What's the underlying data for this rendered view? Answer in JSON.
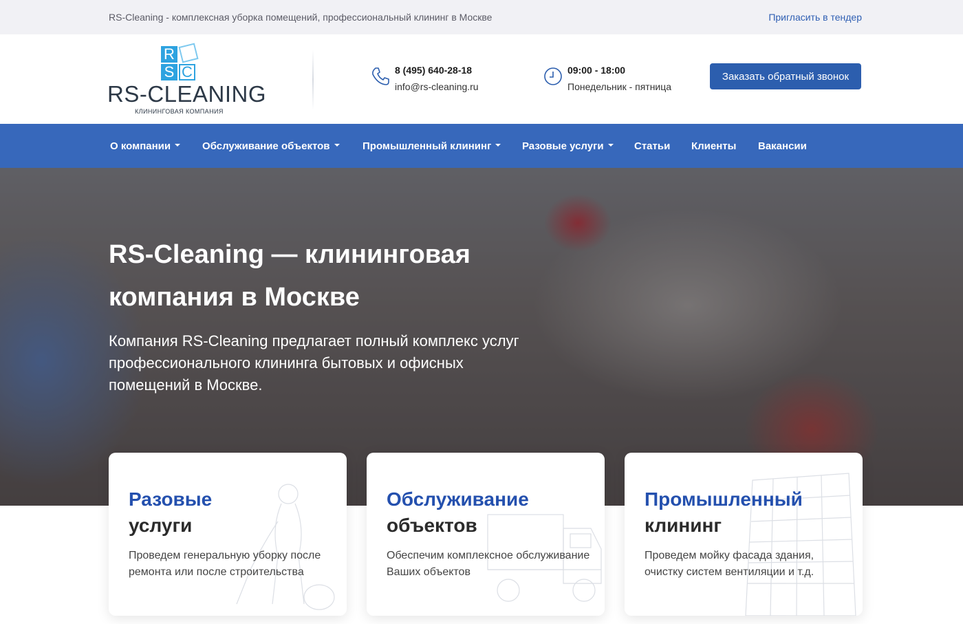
{
  "topbar": {
    "tagline": "RS-Cleaning - комплексная уборка помещений, профессиональный клининг в Москве",
    "tender_link": "Пригласить в тендер"
  },
  "logo": {
    "mark_letters": [
      "R",
      "S",
      "C"
    ],
    "name": "RS-CLEANING",
    "subtitle": "КЛИНИНГОВАЯ КОМПАНИЯ"
  },
  "contacts": {
    "phone": "8 (495) 640-28-18",
    "email": "info@rs-cleaning.ru",
    "hours": "09:00 - 18:00",
    "days": "Понедельник - пятница",
    "phone_icon": "phone-icon",
    "clock_icon": "clock-icon"
  },
  "callback_button": "Заказать обратный звонок",
  "nav": {
    "items": [
      {
        "label": "О компании",
        "dropdown": true
      },
      {
        "label": "Обслуживание объектов",
        "dropdown": true
      },
      {
        "label": "Промышленный клининг",
        "dropdown": true
      },
      {
        "label": "Разовые услуги",
        "dropdown": true
      },
      {
        "label": "Статьи",
        "dropdown": false
      },
      {
        "label": "Клиенты",
        "dropdown": false
      },
      {
        "label": "Вакансии",
        "dropdown": false
      }
    ]
  },
  "hero": {
    "title": "RS-Cleaning — клининговая компания в Москве",
    "subtitle": "Компания RS-Cleaning предлагает полный комплекс услуг профессионального клининга бытовых и офисных помещений в Москве."
  },
  "cards": [
    {
      "title_accent": "Разовые",
      "title_rest": "услуги",
      "desc": "Проведем генеральную уборку после ремонта или после строительства"
    },
    {
      "title_accent": "Обслуживание",
      "title_rest": "объектов",
      "desc": "Обеспечим комплексное обслуживание Ваших объектов"
    },
    {
      "title_accent": "Промышленный",
      "title_rest": "клининг",
      "desc": "Проведем мойку фасада здания, очистку систем вентиляции и т.д."
    }
  ],
  "colors": {
    "brand_blue": "#3768bb",
    "button_blue": "#2c5eae",
    "accent_title": "#2450ae",
    "logo_blue": "#2ea3e0"
  }
}
